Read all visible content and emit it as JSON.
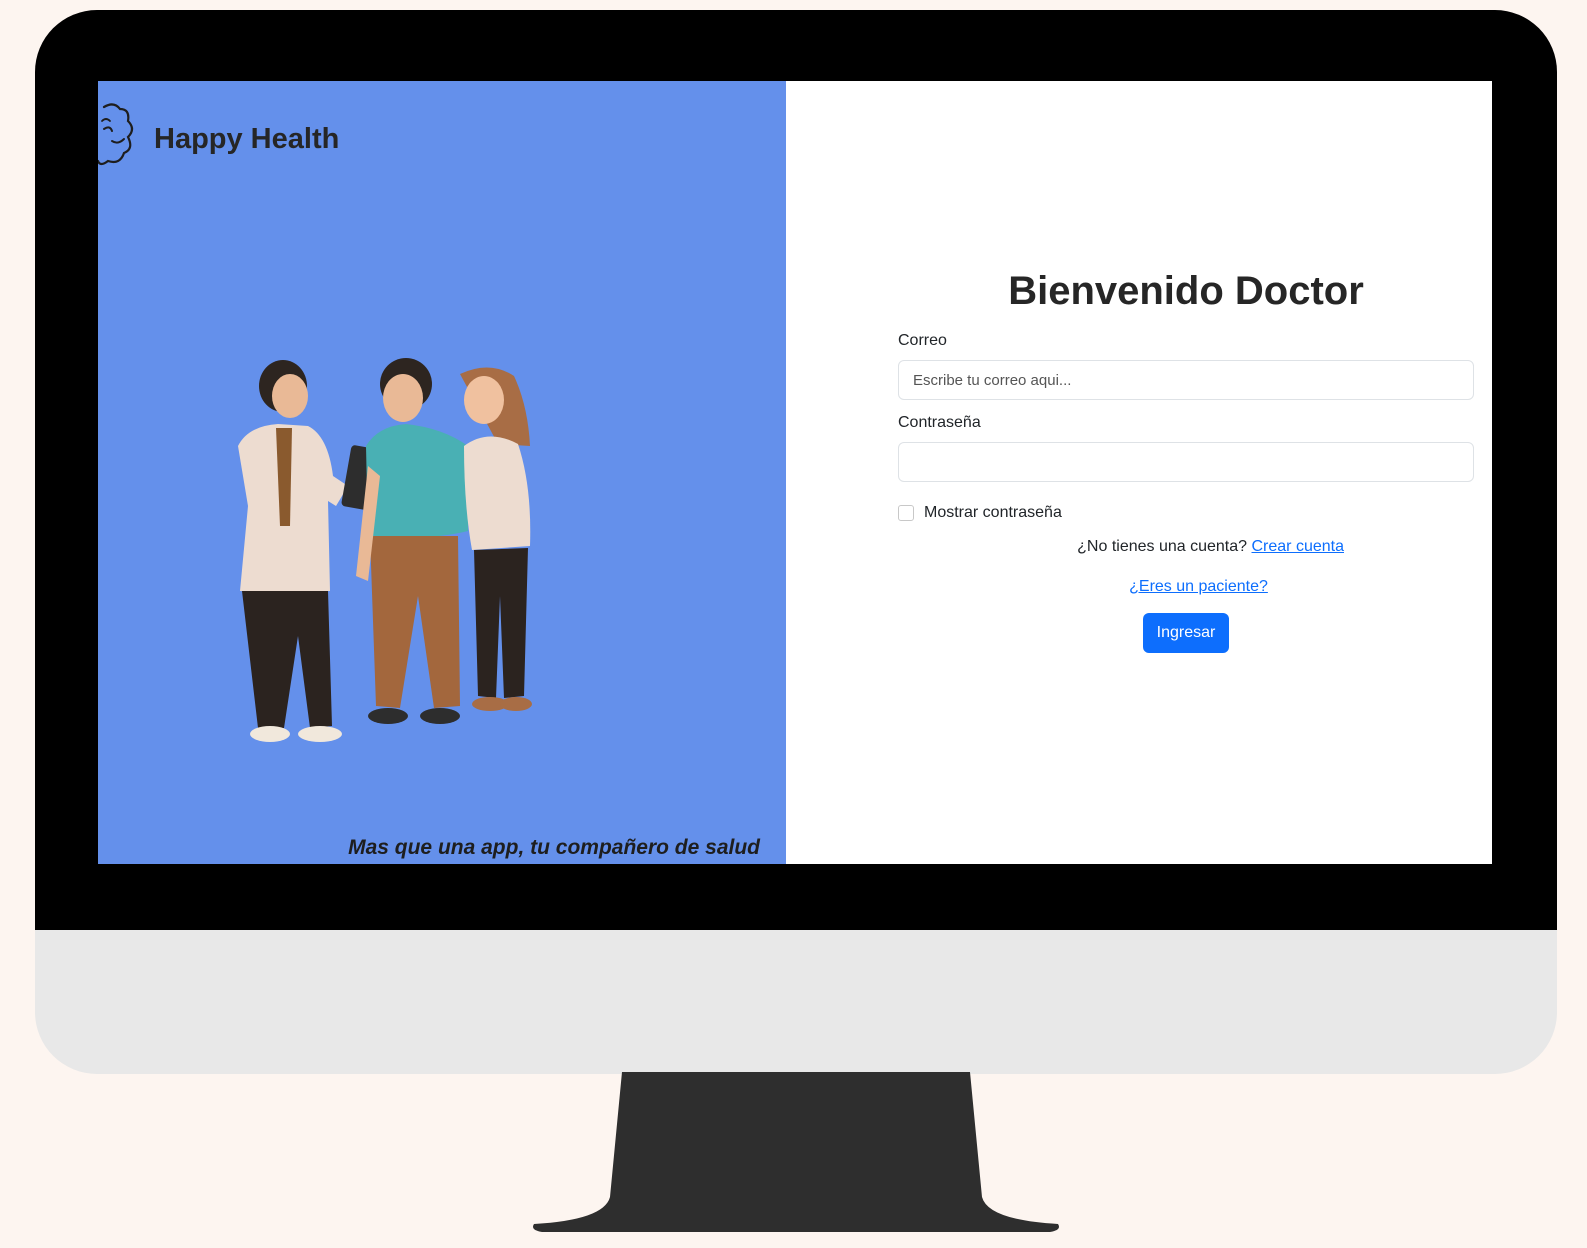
{
  "brand": {
    "name": "Happy Health"
  },
  "tagline": "Mas que una app, tu compañero de salud",
  "login": {
    "title": "Bienvenido Doctor",
    "email_label": "Correo",
    "email_placeholder": "Escribe tu correo aqui...",
    "email_value": "",
    "password_label": "Contraseña",
    "password_value": "",
    "show_password_label": "Mostrar contraseña",
    "show_password_checked": false,
    "no_account_text": "¿No tienes una cuenta?",
    "create_account_link": "Crear cuenta",
    "patient_link": "¿Eres un paciente?",
    "submit_label": "Ingresar"
  },
  "colors": {
    "left_panel": "#6490eb",
    "primary": "#0d6efd",
    "bezel": "#000000",
    "chin": "#e8e8e8",
    "stand": "#2e2e2e",
    "background": "#fdf5f0"
  }
}
